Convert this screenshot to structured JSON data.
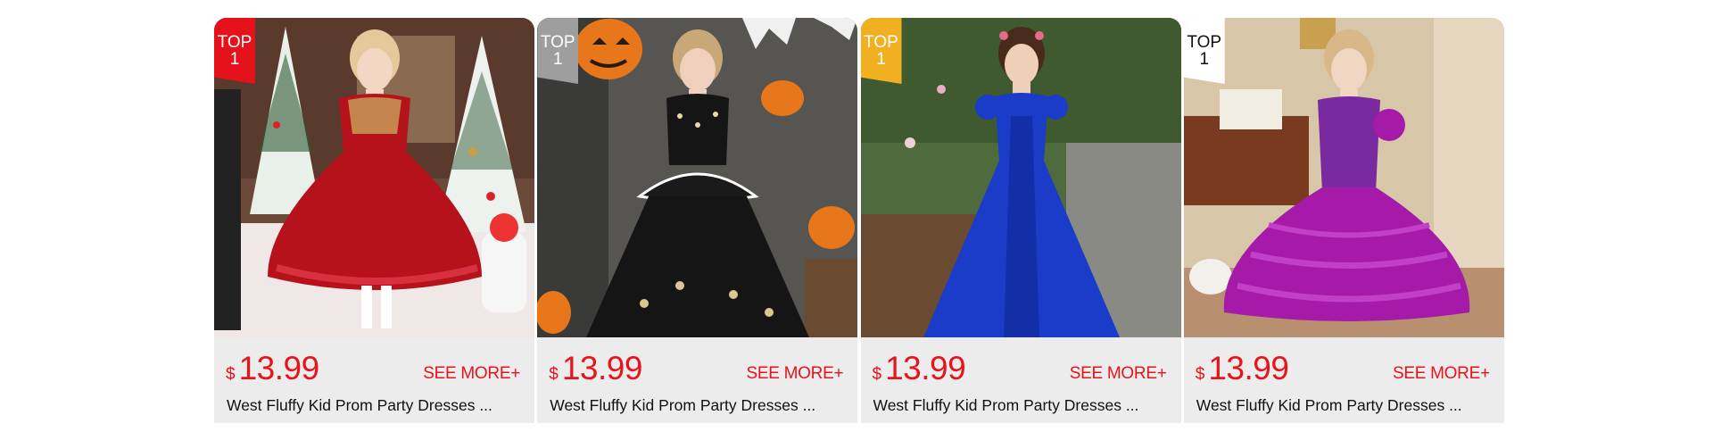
{
  "products": [
    {
      "badge": [
        "TOP",
        "1"
      ],
      "badge_color": "#e5121b",
      "currency": "$",
      "price": "13.99",
      "see_more": "SEE MORE+",
      "title": "West Fluffy Kid Prom Party Dresses ...",
      "dress_color": "#b5121b",
      "image": "girl-red-tutu-dress-christmas-tree-icon"
    },
    {
      "badge": [
        "TOP",
        "1"
      ],
      "badge_color": "#9e9e9e",
      "currency": "$",
      "price": "13.99",
      "see_more": "SEE MORE+",
      "title": "West Fluffy Kid Prom Party Dresses ...",
      "dress_color": "#151515",
      "image": "girl-black-sequin-dress-halloween-pumpkin-icon"
    },
    {
      "badge": [
        "TOP",
        "1"
      ],
      "badge_color": "#f0b020",
      "currency": "$",
      "price": "13.99",
      "see_more": "SEE MORE+",
      "title": "West Fluffy Kid Prom Party Dresses ...",
      "dress_color": "#1a3cc8",
      "image": "girl-blue-sequin-gown-garden-icon"
    },
    {
      "badge": [
        "TOP",
        "1"
      ],
      "badge_color": "#ffffff",
      "badge_text_color": "#111111",
      "currency": "$",
      "price": "13.99",
      "see_more": "SEE MORE+",
      "title": "West Fluffy Kid Prom Party Dresses ...",
      "dress_color": "#a51aa8",
      "image": "girl-purple-ruffle-dress-piano-icon"
    }
  ]
}
